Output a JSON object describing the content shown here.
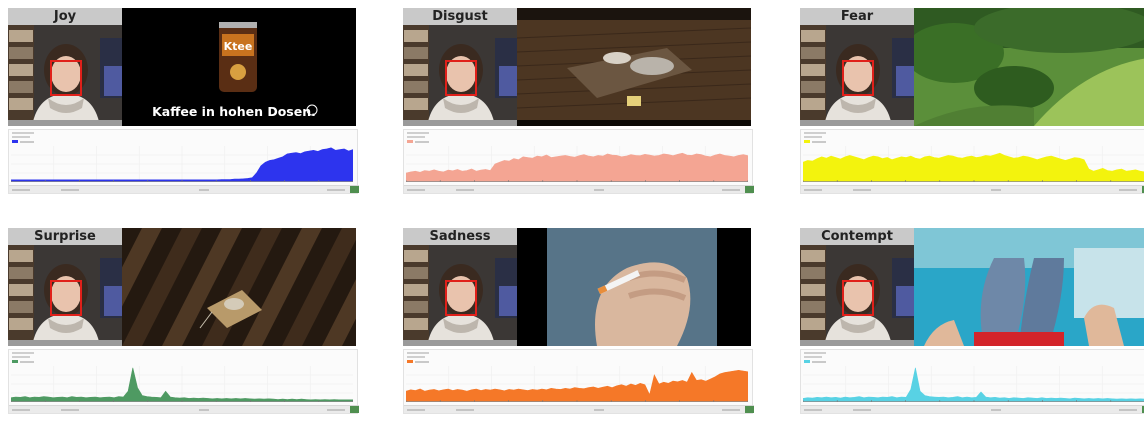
{
  "colors": {
    "joy": "#2d34ee",
    "disgust": "#f4a593",
    "fear": "#f3f30d",
    "surprise": "#4e9a62",
    "sadness": "#f57828",
    "contempt": "#58d2e4"
  },
  "panels": [
    {
      "id": "joy",
      "label": "Joy",
      "stimulus": "coffee-ad",
      "ad_brand": "Ktee",
      "ad_slogan": "Kaffee in hohen Dosen.",
      "series_color": "#2d34ee",
      "series": [
        0.06,
        0.06,
        0.06,
        0.06,
        0.06,
        0.06,
        0.06,
        0.06,
        0.06,
        0.06,
        0.06,
        0.06,
        0.06,
        0.06,
        0.06,
        0.06,
        0.06,
        0.06,
        0.06,
        0.06,
        0.06,
        0.06,
        0.06,
        0.06,
        0.06,
        0.06,
        0.06,
        0.06,
        0.06,
        0.06,
        0.06,
        0.06,
        0.06,
        0.06,
        0.06,
        0.06,
        0.06,
        0.06,
        0.06,
        0.06,
        0.06,
        0.06,
        0.06,
        0.06,
        0.06,
        0.06,
        0.06,
        0.06,
        0.07,
        0.07,
        0.07,
        0.08,
        0.08,
        0.09,
        0.1,
        0.12,
        0.25,
        0.45,
        0.55,
        0.6,
        0.62,
        0.66,
        0.7,
        0.78,
        0.8,
        0.82,
        0.79,
        0.84,
        0.86,
        0.88,
        0.85,
        0.9,
        0.92,
        0.95,
        0.88,
        0.9,
        0.92,
        0.86,
        0.9
      ]
    },
    {
      "id": "disgust",
      "label": "Disgust",
      "stimulus": "dead-mouse-trap",
      "series_color": "#f4a593",
      "series": [
        0.25,
        0.28,
        0.3,
        0.27,
        0.32,
        0.3,
        0.34,
        0.3,
        0.28,
        0.33,
        0.31,
        0.35,
        0.3,
        0.32,
        0.36,
        0.3,
        0.33,
        0.35,
        0.32,
        0.5,
        0.55,
        0.6,
        0.58,
        0.65,
        0.62,
        0.7,
        0.68,
        0.66,
        0.72,
        0.7,
        0.75,
        0.68,
        0.7,
        0.72,
        0.74,
        0.71,
        0.69,
        0.73,
        0.76,
        0.72,
        0.7,
        0.74,
        0.72,
        0.78,
        0.75,
        0.74,
        0.7,
        0.72,
        0.76,
        0.74,
        0.73,
        0.77,
        0.75,
        0.72,
        0.74,
        0.78,
        0.76,
        0.73,
        0.77,
        0.8,
        0.75,
        0.74,
        0.78,
        0.76,
        0.72,
        0.7,
        0.75,
        0.78,
        0.74,
        0.72,
        0.7,
        0.74,
        0.76,
        0.73
      ]
    },
    {
      "id": "fear",
      "label": "Fear",
      "stimulus": "forest-hillside",
      "series_color": "#f3f30d",
      "series": [
        0.55,
        0.6,
        0.58,
        0.65,
        0.7,
        0.66,
        0.72,
        0.68,
        0.64,
        0.7,
        0.74,
        0.7,
        0.66,
        0.62,
        0.68,
        0.72,
        0.7,
        0.65,
        0.68,
        0.62,
        0.66,
        0.7,
        0.68,
        0.72,
        0.66,
        0.64,
        0.7,
        0.72,
        0.68,
        0.66,
        0.7,
        0.74,
        0.72,
        0.68,
        0.66,
        0.7,
        0.72,
        0.68,
        0.7,
        0.74,
        0.72,
        0.76,
        0.8,
        0.74,
        0.7,
        0.66,
        0.68,
        0.72,
        0.7,
        0.66,
        0.62,
        0.66,
        0.7,
        0.72,
        0.68,
        0.64,
        0.6,
        0.64,
        0.68,
        0.66,
        0.62,
        0.36,
        0.3,
        0.34,
        0.38,
        0.32,
        0.3,
        0.34,
        0.36,
        0.3,
        0.32,
        0.34,
        0.3,
        0.28
      ]
    },
    {
      "id": "surprise",
      "label": "Surprise",
      "stimulus": "mouse-in-trap",
      "series_color": "#4e9a62",
      "series": [
        0.12,
        0.14,
        0.13,
        0.15,
        0.12,
        0.14,
        0.13,
        0.15,
        0.14,
        0.12,
        0.13,
        0.14,
        0.12,
        0.15,
        0.13,
        0.14,
        0.12,
        0.13,
        0.14,
        0.12,
        0.13,
        0.14,
        0.12,
        0.15,
        0.14,
        0.3,
        0.95,
        0.4,
        0.18,
        0.15,
        0.14,
        0.13,
        0.12,
        0.3,
        0.14,
        0.12,
        0.11,
        0.12,
        0.1,
        0.11,
        0.1,
        0.11,
        0.1,
        0.09,
        0.1,
        0.09,
        0.1,
        0.09,
        0.1,
        0.09,
        0.1,
        0.09,
        0.08,
        0.09,
        0.08,
        0.09,
        0.08,
        0.07,
        0.08,
        0.07,
        0.08,
        0.07,
        0.08,
        0.07,
        0.06,
        0.07,
        0.06,
        0.07,
        0.06,
        0.07,
        0.06,
        0.06,
        0.06,
        0.06
      ]
    },
    {
      "id": "sadness",
      "label": "Sadness",
      "stimulus": "hand-cigarette",
      "series_color": "#f57828",
      "series": [
        0.3,
        0.34,
        0.32,
        0.36,
        0.3,
        0.33,
        0.35,
        0.31,
        0.34,
        0.36,
        0.32,
        0.35,
        0.33,
        0.3,
        0.34,
        0.36,
        0.32,
        0.35,
        0.33,
        0.36,
        0.34,
        0.31,
        0.35,
        0.33,
        0.36,
        0.34,
        0.32,
        0.35,
        0.33,
        0.36,
        0.34,
        0.38,
        0.36,
        0.35,
        0.38,
        0.36,
        0.4,
        0.38,
        0.37,
        0.4,
        0.42,
        0.38,
        0.41,
        0.44,
        0.4,
        0.45,
        0.48,
        0.44,
        0.5,
        0.46,
        0.52,
        0.48,
        0.2,
        0.75,
        0.5,
        0.55,
        0.52,
        0.58,
        0.56,
        0.6,
        0.55,
        0.82,
        0.6,
        0.62,
        0.58,
        0.64,
        0.7,
        0.78,
        0.82,
        0.84,
        0.86,
        0.88,
        0.86,
        0.84
      ]
    },
    {
      "id": "contempt",
      "label": "Contempt",
      "stimulus": "legs-on-boat",
      "series_color": "#58d2e4",
      "series": [
        0.1,
        0.12,
        0.11,
        0.13,
        0.12,
        0.14,
        0.12,
        0.13,
        0.11,
        0.14,
        0.12,
        0.13,
        0.15,
        0.12,
        0.14,
        0.13,
        0.12,
        0.14,
        0.13,
        0.15,
        0.12,
        0.14,
        0.13,
        0.35,
        0.95,
        0.3,
        0.18,
        0.15,
        0.14,
        0.13,
        0.14,
        0.12,
        0.13,
        0.15,
        0.12,
        0.14,
        0.12,
        0.13,
        0.28,
        0.14,
        0.12,
        0.13,
        0.11,
        0.12,
        0.1,
        0.12,
        0.11,
        0.1,
        0.12,
        0.11,
        0.1,
        0.12,
        0.1,
        0.11,
        0.1,
        0.11,
        0.1,
        0.09,
        0.11,
        0.1,
        0.09,
        0.1,
        0.09,
        0.1,
        0.09,
        0.1,
        0.09,
        0.08,
        0.09,
        0.08,
        0.09,
        0.08,
        0.09,
        0.08
      ]
    }
  ]
}
